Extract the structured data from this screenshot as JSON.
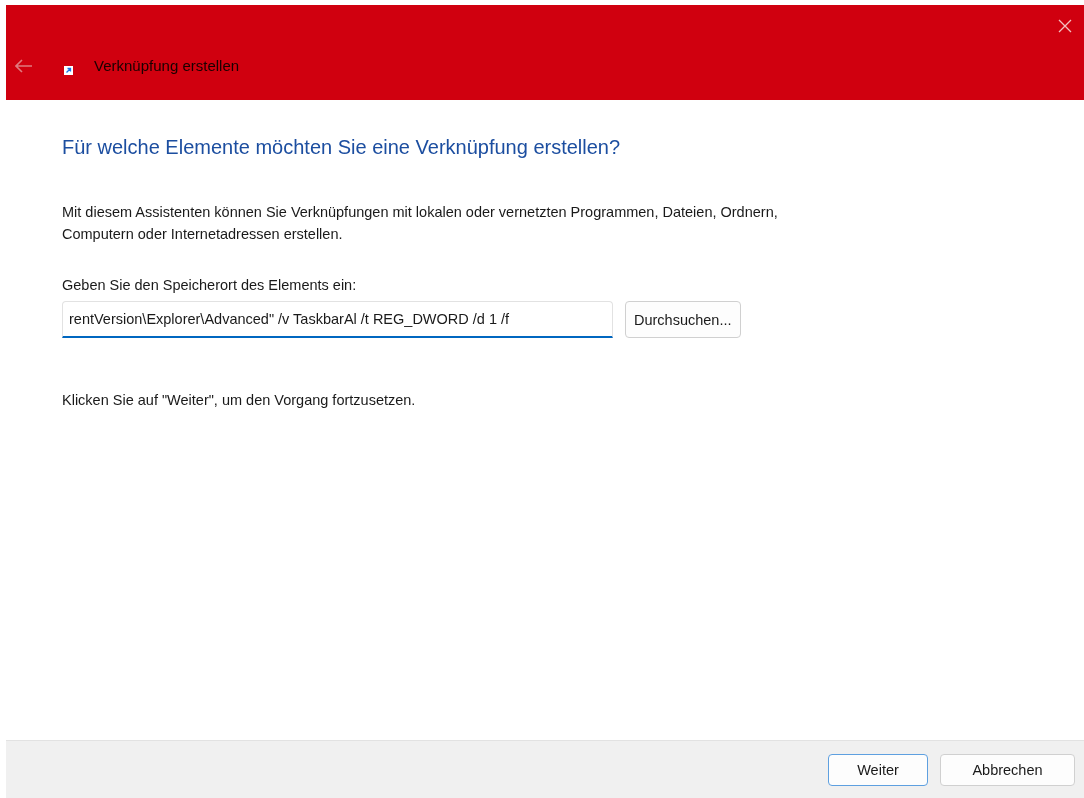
{
  "window": {
    "title": "Verknüpfung erstellen"
  },
  "heading": "Für welche Elemente möchten Sie eine Verknüpfung erstellen?",
  "intro": "Mit diesem Assistenten können Sie Verknüpfungen mit lokalen oder vernetzten Programmen, Dateien, Ordnern, Computern oder Internetadressen erstellen.",
  "location": {
    "label": "Geben Sie den Speicherort des Elements ein:",
    "value": "rentVersion\\Explorer\\Advanced\" /v TaskbarAl /t REG_DWORD /d 1 /f",
    "browse_button": "Durchsuchen..."
  },
  "hint": "Klicken Sie auf \"Weiter\", um den Vorgang fortzusetzen.",
  "buttons": [
    {
      "label": "Weiter",
      "default": true
    },
    {
      "label": "Abbrechen",
      "default": false
    }
  ]
}
